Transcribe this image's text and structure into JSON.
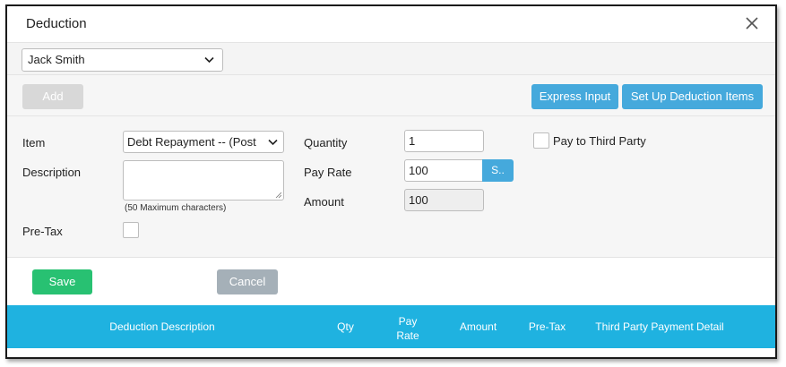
{
  "dialog": {
    "title": "Deduction"
  },
  "employee": {
    "selected": "Jack Smith"
  },
  "toolbar": {
    "add_label": "Add",
    "express_label": "Express Input",
    "setup_label": "Set Up Deduction Items"
  },
  "form": {
    "item_label": "Item",
    "item_value": "Debt Repayment -- (Post",
    "description_label": "Description",
    "description_value": "",
    "description_hint": "(50 Maximum characters)",
    "pretax_label": "Pre-Tax",
    "pretax_checked": false,
    "quantity_label": "Quantity",
    "quantity_value": "1",
    "pay_rate_label": "Pay Rate",
    "pay_rate_value": "100",
    "s_button_label": "S..",
    "amount_label": "Amount",
    "amount_value": "100",
    "third_party_label": "Pay to Third Party",
    "third_party_checked": false
  },
  "actions": {
    "save_label": "Save",
    "cancel_label": "Cancel"
  },
  "table": {
    "columns": [
      {
        "label": "Deduction Description"
      },
      {
        "label": "Qty"
      },
      {
        "label": "Pay Rate",
        "line1": "Pay",
        "line2": "Rate"
      },
      {
        "label": "Amount"
      },
      {
        "label": "Pre-Tax"
      },
      {
        "label": "Third Party Payment Detail"
      }
    ],
    "rows": []
  },
  "colors": {
    "primary_blue": "#45a9dc",
    "header_blue": "#1fb2e0",
    "save_green": "#28c172",
    "cancel_gray": "#a5b0b8",
    "disabled_gray": "#d8d8d8"
  },
  "icons": {
    "close": "close-icon",
    "dropdown": "chevron-down-icon",
    "resize": "resize-grip-icon"
  }
}
